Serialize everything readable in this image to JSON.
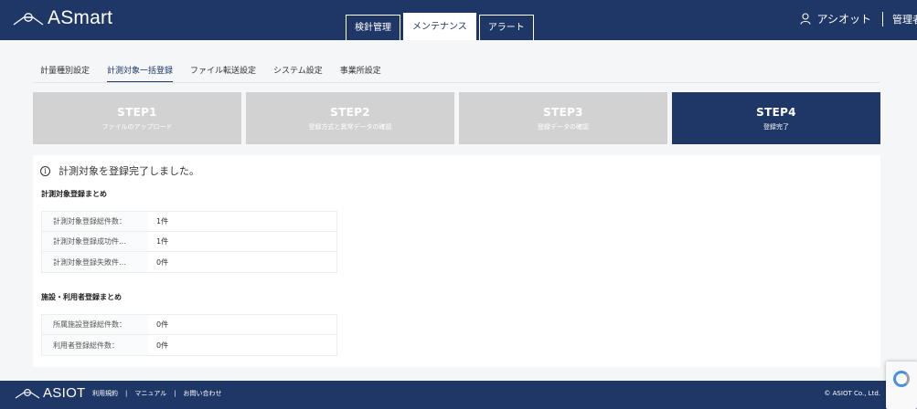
{
  "header": {
    "app_name": "ASmart",
    "tabs": [
      {
        "label": "検針管理",
        "active": false
      },
      {
        "label": "メンテナンス",
        "active": true
      },
      {
        "label": "アラート",
        "active": false
      }
    ],
    "user_name": "アシオット",
    "user_role": "管理者"
  },
  "subnav": {
    "items": [
      {
        "label": "計量種別設定",
        "active": false
      },
      {
        "label": "計測対象一括登録",
        "active": true
      },
      {
        "label": "ファイル転送設定",
        "active": false
      },
      {
        "label": "システム設定",
        "active": false
      },
      {
        "label": "事業所設定",
        "active": false
      }
    ]
  },
  "steps": [
    {
      "title": "STEP1",
      "desc": "ファイルのアップロード",
      "state": "inactive"
    },
    {
      "title": "STEP2",
      "desc": "登録方式と異常データの確認",
      "state": "inactive"
    },
    {
      "title": "STEP3",
      "desc": "登録データの確認",
      "state": "inactive"
    },
    {
      "title": "STEP4",
      "desc": "登録完了",
      "state": "active"
    }
  ],
  "result": {
    "message": "計測対象を登録完了しました。",
    "info_icon": "info-circle-icon",
    "section1": {
      "title": "計測対象登録まとめ",
      "rows": [
        {
          "label": "計測対象登録総件数：",
          "value": "1件"
        },
        {
          "label": "計測対象登録成功件…",
          "value": "1件"
        },
        {
          "label": "計測対象登録失敗件…",
          "value": "0件"
        }
      ]
    },
    "section2": {
      "title": "施設・利用者登録まとめ",
      "rows": [
        {
          "label": "所属施設登録総件数：",
          "value": "0件"
        },
        {
          "label": "利用者登録総件数：",
          "value": "0件"
        }
      ]
    }
  },
  "footer": {
    "brand": "ASIOT",
    "links": [
      "利用規約",
      "マニュアル",
      "お問い合わせ"
    ],
    "link_separator": "|",
    "copyright": "© ASIOT Co., Ltd."
  },
  "colors": {
    "primary": "#1f3766",
    "step_inactive": "#d2d2d2",
    "background": "#f5f6f8"
  }
}
